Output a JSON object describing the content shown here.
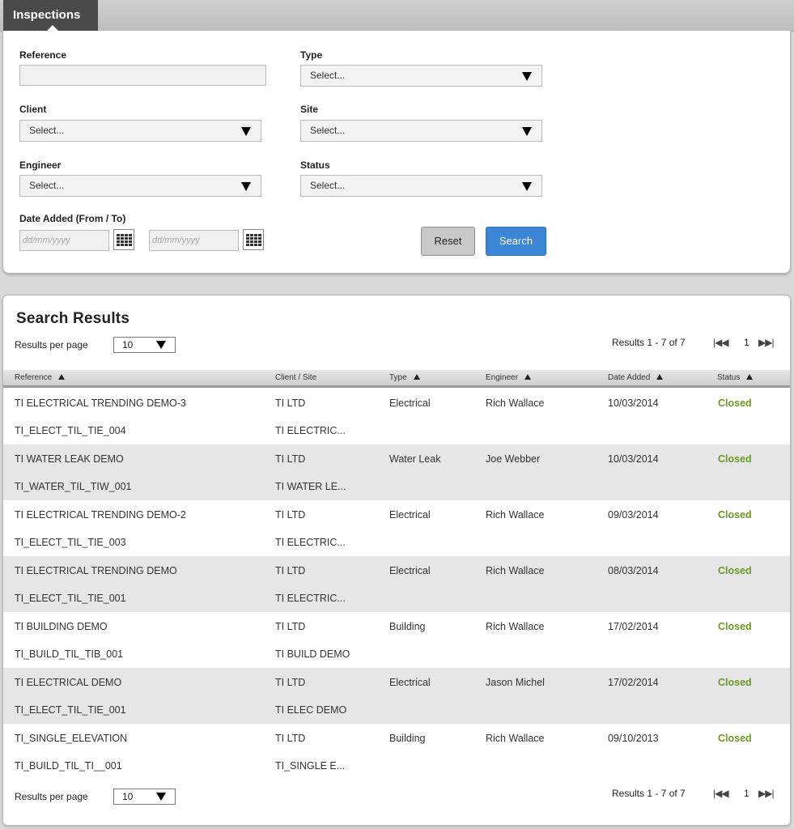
{
  "tab": {
    "label": "Inspections"
  },
  "filters": {
    "reference": {
      "label": "Reference",
      "value": ""
    },
    "type": {
      "label": "Type",
      "value": "Select..."
    },
    "client": {
      "label": "Client",
      "value": "Select..."
    },
    "site": {
      "label": "Site",
      "value": "Select..."
    },
    "engineer": {
      "label": "Engineer",
      "value": "Select..."
    },
    "status": {
      "label": "Status",
      "value": "Select..."
    },
    "date_added": {
      "label": "Date Added (From / To)",
      "from_placeholder": "dd/mm/yyyy",
      "to_placeholder": "dd/mm/yyyy"
    },
    "reset_label": "Reset",
    "search_label": "Search"
  },
  "results": {
    "title": "Search Results",
    "per_page_label": "Results per page",
    "per_page_value": "10",
    "summary": "Results 1 - 7 of 7",
    "page": "1",
    "columns": {
      "reference": "Reference",
      "client_site": "Client / Site",
      "type": "Type",
      "engineer": "Engineer",
      "date_added": "Date Added",
      "status": "Status"
    },
    "rows": [
      {
        "ref": "TI ELECTRICAL TRENDING DEMO-3",
        "ref2": "TI_ELECT_TIL_TIE_004",
        "client": "TI LTD",
        "site": "TI ELECTRIC...",
        "type": "Electrical",
        "engineer": "Rich Wallace",
        "date": "10/03/2014",
        "status": "Closed"
      },
      {
        "ref": "TI WATER LEAK DEMO",
        "ref2": "TI_WATER_TIL_TIW_001",
        "client": "TI LTD",
        "site": "TI WATER LE...",
        "type": "Water Leak",
        "engineer": "Joe Webber",
        "date": "10/03/2014",
        "status": "Closed"
      },
      {
        "ref": "TI ELECTRICAL TRENDING DEMO-2",
        "ref2": "TI_ELECT_TIL_TIE_003",
        "client": "TI LTD",
        "site": "TI ELECTRIC...",
        "type": "Electrical",
        "engineer": "Rich Wallace",
        "date": "09/03/2014",
        "status": "Closed"
      },
      {
        "ref": "TI ELECTRICAL TRENDING DEMO",
        "ref2": "TI_ELECT_TIL_TIE_001",
        "client": "TI LTD",
        "site": "TI ELECTRIC...",
        "type": "Electrical",
        "engineer": "Rich Wallace",
        "date": "08/03/2014",
        "status": "Closed"
      },
      {
        "ref": "TI BUILDING DEMO",
        "ref2": "TI_BUILD_TIL_TIB_001",
        "client": "TI LTD",
        "site": "TI BUILD DEMO",
        "type": "Building",
        "engineer": "Rich Wallace",
        "date": "17/02/2014",
        "status": "Closed"
      },
      {
        "ref": "TI ELECTRICAL DEMO",
        "ref2": "TI_ELECT_TIL_TIE_001",
        "client": "TI LTD",
        "site": "TI ELEC DEMO",
        "type": "Electrical",
        "engineer": "Jason Michel",
        "date": "17/02/2014",
        "status": "Closed"
      },
      {
        "ref": "TI_SINGLE_ELEVATION",
        "ref2": "TI_BUILD_TIL_TI__001",
        "client": "TI LTD",
        "site": "TI_SINGLE E...",
        "type": "Building",
        "engineer": "Rich Wallace",
        "date": "09/10/2013",
        "status": "Closed"
      }
    ]
  },
  "colors": {
    "accent": "#3b86d6",
    "status_closed": "#6a9a24",
    "tab_bg": "#4a4a4a"
  }
}
